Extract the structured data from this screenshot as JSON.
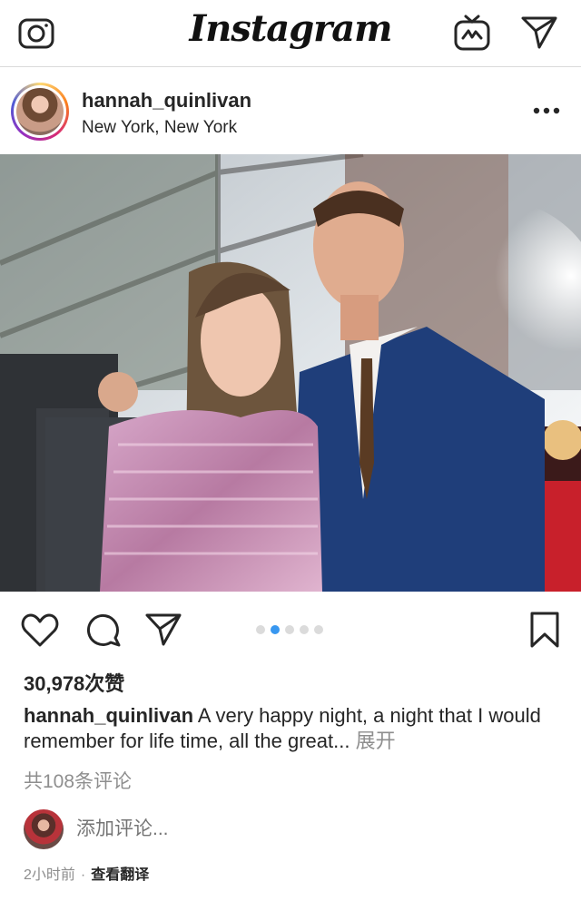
{
  "app": {
    "logo": "Instagram",
    "icons": {
      "camera": "camera-icon",
      "igtv": "igtv-icon",
      "direct": "paper-plane-icon"
    }
  },
  "post": {
    "username": "hannah_quinlivan",
    "location": "New York, New York",
    "photo_alt": "Two people posing on a red carpet",
    "carousel": {
      "count": 5,
      "active_index": 1
    },
    "likes": "30,978次赞",
    "caption_user": "hannah_quinlivan",
    "caption_text": " A very happy night, a night that I would remember for life time, all the great... ",
    "caption_more": "展开",
    "comments_link": "共108条评论",
    "add_comment_placeholder": "添加评论...",
    "time_ago": "2小时前",
    "separator": "·",
    "translate_label": "查看翻译"
  },
  "colors": {
    "accent": "#3897f0",
    "muted": "#8e8e8e",
    "text": "#262626"
  }
}
